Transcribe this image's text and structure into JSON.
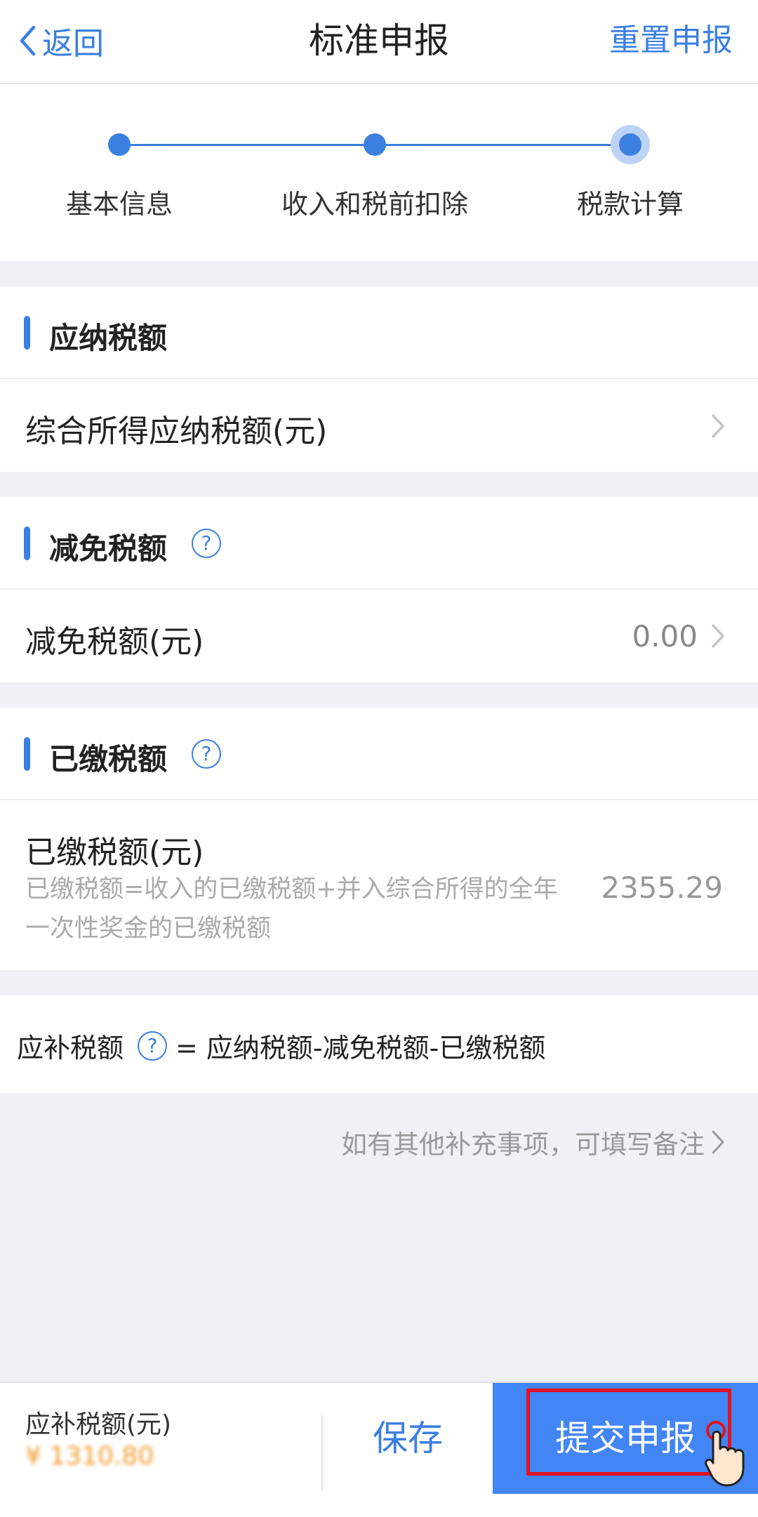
{
  "nav": {
    "back_label": "返回",
    "title": "标准申报",
    "reset_label": "重置申报"
  },
  "steps": [
    {
      "label": "基本信息",
      "state": "done"
    },
    {
      "label": "收入和税前扣除",
      "state": "done"
    },
    {
      "label": "税款计算",
      "state": "current"
    }
  ],
  "tax_payable": {
    "section_title": "应纳税额",
    "row_label": "综合所得应纳税额(元)",
    "row_value": ""
  },
  "tax_relief": {
    "section_title": "减免税额",
    "row_label": "减免税额(元)",
    "row_value": "0.00"
  },
  "tax_paid": {
    "section_title": "已缴税额",
    "row_label": "已缴税额(元)",
    "note_line1": "已缴税额=收入的已缴税额+并入综合所得的全年",
    "note_line2": "一次性奖金的已缴税额",
    "row_value": "2355.29"
  },
  "formula": {
    "label": "应补税额",
    "expression": "= 应纳税额-减免税额-已缴税额"
  },
  "remark_link": "如有其他补充事项，可填写备注",
  "bottom_bar": {
    "due_label": "应补税额(元)",
    "due_value": "¥ 1310.80",
    "save_label": "保存",
    "submit_label": "提交申报"
  },
  "colors": {
    "accent": "#3b7fe0",
    "submit_bg": "#4285f4",
    "amount_orange": "#f19a2a",
    "highlight_red": "#e3101b"
  },
  "icons": {
    "back": "chevron-left-icon",
    "help": "question-circle-icon",
    "row_arrow": "chevron-right-icon",
    "pointer": "hand-pointer-icon"
  }
}
